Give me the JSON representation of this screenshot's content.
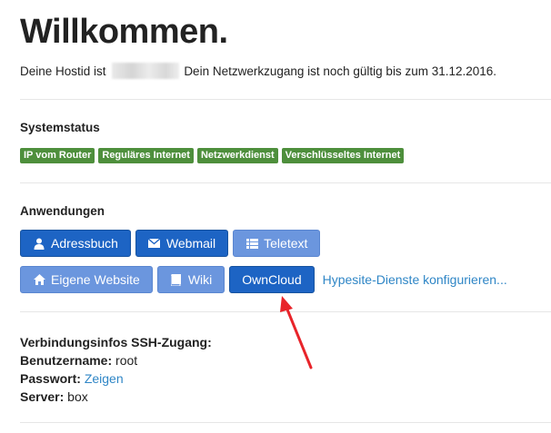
{
  "header": {
    "title": "Willkommen."
  },
  "intro": {
    "prefix": "Deine Hostid ist",
    "suffix": "Dein Netzwerkzugang ist noch gültig bis zum 31.12.2016."
  },
  "systemstatus": {
    "title": "Systemstatus",
    "badges": [
      "IP vom Router",
      "Reguläres Internet",
      "Netzwerkdienst",
      "Verschlüsseltes Internet"
    ],
    "badge_color": "#4e8f3c"
  },
  "anwendungen": {
    "title": "Anwendungen",
    "row1": [
      {
        "label": "Adressbuch",
        "icon": "user-icon",
        "style": "primary"
      },
      {
        "label": "Webmail",
        "icon": "envelope-icon",
        "style": "primary"
      },
      {
        "label": "Teletext",
        "icon": "list-icon",
        "style": "light"
      }
    ],
    "row2": [
      {
        "label": "Eigene Website",
        "icon": "home-icon",
        "style": "light"
      },
      {
        "label": "Wiki",
        "icon": "book-icon",
        "style": "light"
      },
      {
        "label": "OwnCloud",
        "icon": "",
        "style": "primary"
      }
    ],
    "configure_link": "Hypesite-Dienste konfigurieren..."
  },
  "ssh": {
    "title": "Verbindungsinfos SSH-Zugang:",
    "username_label": "Benutzername:",
    "username": "root",
    "password_label": "Passwort:",
    "password_link": "Zeigen",
    "server_label": "Server:",
    "server": "box"
  },
  "colors": {
    "primary": "#1d64c4",
    "light": "#6b96de",
    "link": "#2f86c6",
    "arrow": "#e8242a"
  }
}
